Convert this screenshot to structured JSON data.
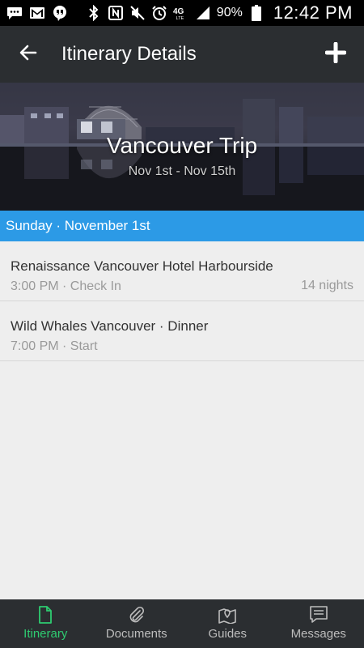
{
  "status_bar": {
    "battery_percent": "90%",
    "time": "12:42 PM",
    "network_label": "4G LTE",
    "icons": [
      "chat-icon",
      "gmail-icon",
      "hangouts-icon",
      "bluetooth-icon",
      "nfc-icon",
      "mute-icon",
      "alarm-icon",
      "network-4g-icon",
      "signal-icon",
      "battery-icon"
    ]
  },
  "toolbar": {
    "title": "Itinerary Details",
    "back_icon": "arrow-left-icon",
    "add_icon": "plus-icon"
  },
  "hero": {
    "title": "Vancouver Trip",
    "dates": "Nov 1st - Nov 15th"
  },
  "day": {
    "label": "Sunday · November 1st"
  },
  "items": [
    {
      "title": "Renaissance Vancouver Hotel Harbourside",
      "subtitle": "3:00 PM · Check In",
      "right": "14 nights"
    },
    {
      "title": "Wild Whales Vancouver · Dinner",
      "subtitle": "7:00 PM · Start"
    }
  ],
  "nav": [
    {
      "label": "Itinerary",
      "icon": "document-icon",
      "active": true
    },
    {
      "label": "Documents",
      "icon": "paperclip-icon",
      "active": false
    },
    {
      "label": "Guides",
      "icon": "map-pin-icon",
      "active": false
    },
    {
      "label": "Messages",
      "icon": "message-icon",
      "active": false
    }
  ],
  "colors": {
    "toolbar": "#2b2e31",
    "day_header": "#2c9ae6",
    "active_nav": "#2ecc71",
    "background": "#eeeeee"
  }
}
